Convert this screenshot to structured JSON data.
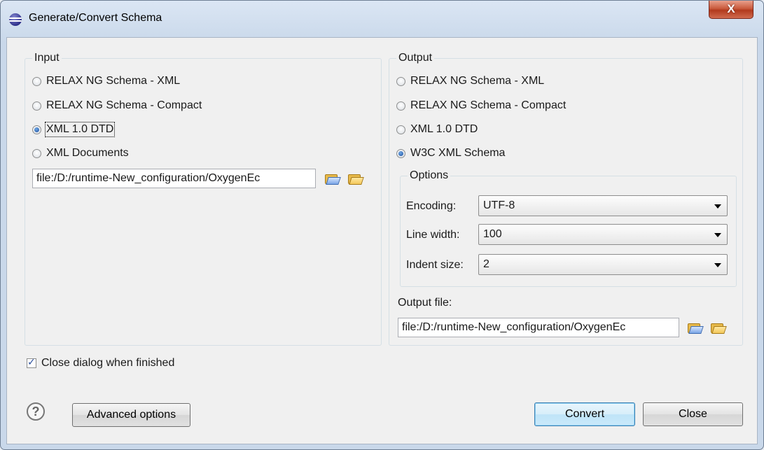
{
  "window": {
    "title": "Generate/Convert Schema",
    "close_glyph": "X"
  },
  "input": {
    "legend": "Input",
    "options": [
      {
        "label": "RELAX NG Schema - XML",
        "checked": false
      },
      {
        "label": "RELAX NG Schema - Compact",
        "checked": false
      },
      {
        "label": "XML 1.0 DTD",
        "checked": true
      },
      {
        "label": "XML Documents",
        "checked": false
      }
    ],
    "file_value": "file:/D:/runtime-New_configuration/OxygenEc"
  },
  "output": {
    "legend": "Output",
    "options": [
      {
        "label": "RELAX NG Schema - XML",
        "checked": false
      },
      {
        "label": "RELAX NG Schema - Compact",
        "checked": false
      },
      {
        "label": "XML 1.0 DTD",
        "checked": false
      },
      {
        "label": "W3C XML Schema",
        "checked": true
      }
    ],
    "options_group": {
      "legend": "Options",
      "encoding_label": "Encoding:",
      "encoding_value": "UTF-8",
      "line_width_label": "Line width:",
      "line_width_value": "100",
      "indent_size_label": "Indent size:",
      "indent_size_value": "2"
    },
    "output_file_label": "Output file:",
    "output_file_value": "file:/D:/runtime-New_configuration/OxygenEc"
  },
  "close_when_finished": {
    "label": "Close dialog when finished",
    "checked": true
  },
  "footer": {
    "help_glyph": "?",
    "advanced_label": "Advanced options",
    "convert_label": "Convert",
    "close_label": "Close"
  },
  "icons": [
    "eclipse-app-icon",
    "browse-url-icon",
    "browse-folder-icon",
    "help-icon",
    "close-icon"
  ]
}
